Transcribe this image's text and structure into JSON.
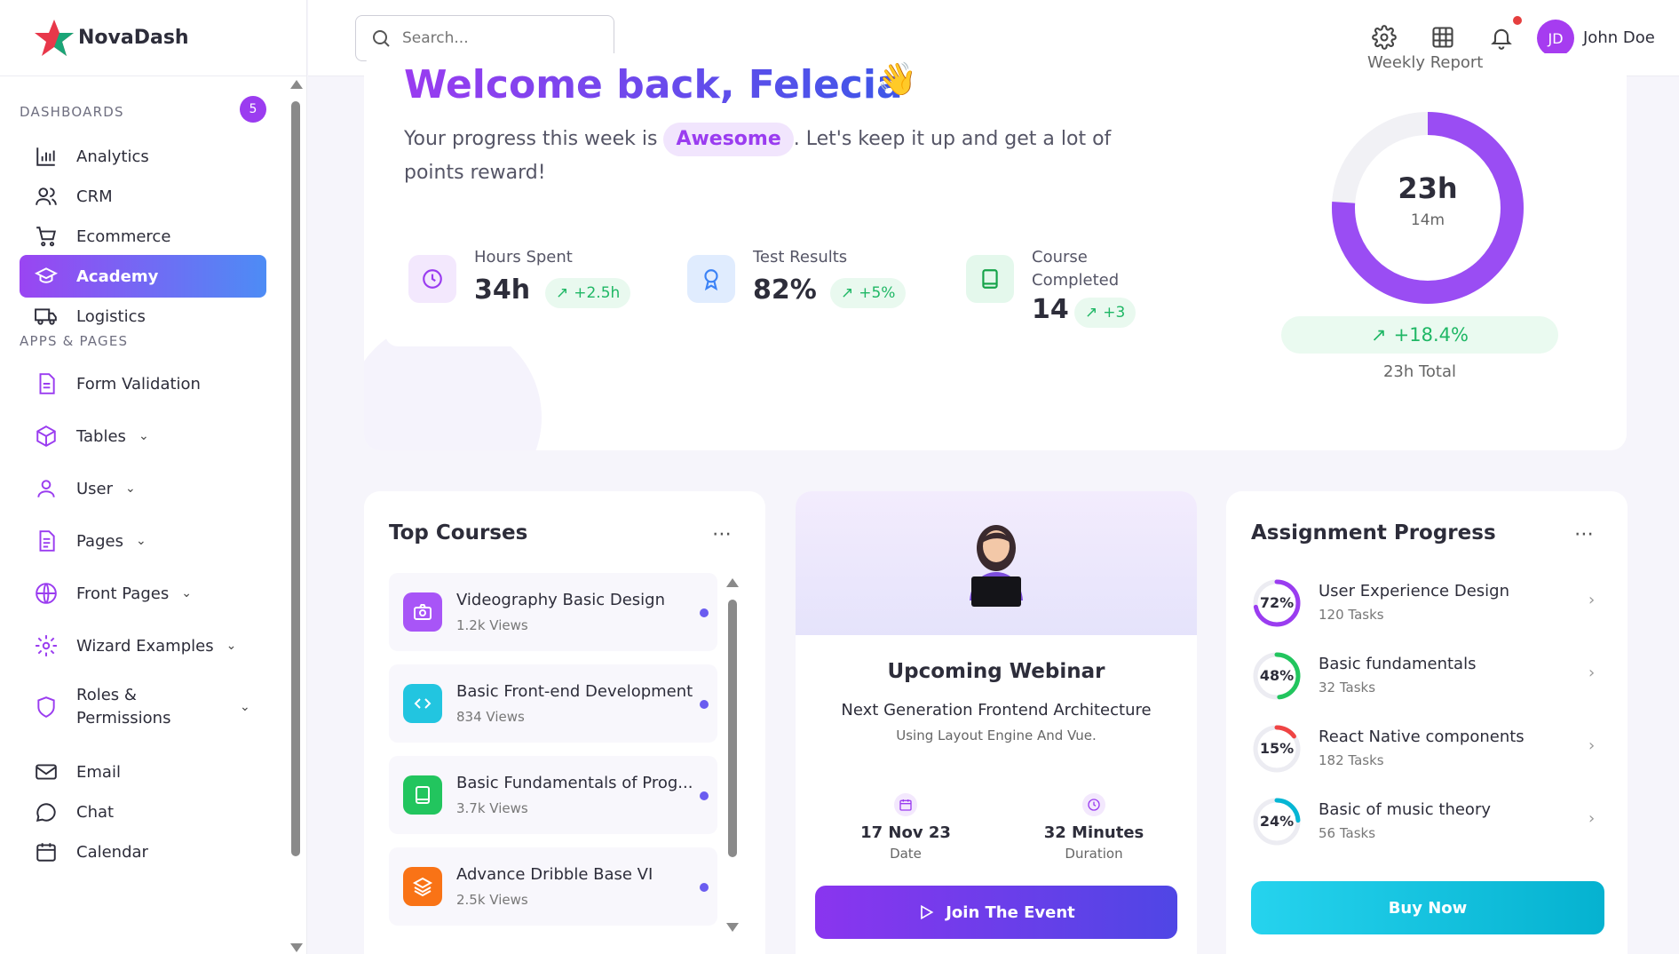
{
  "brand": {
    "name": "NovaDash",
    "icon": "star-logo"
  },
  "search": {
    "placeholder": "Search..."
  },
  "user": {
    "initials": "JD",
    "name": "John Doe"
  },
  "sidebar": {
    "dashboards_title": "DASHBOARDS",
    "dashboards_badge": "5",
    "apps_title": "APPS & PAGES",
    "items": [
      {
        "label": "Analytics",
        "icon": "bar-chart-icon"
      },
      {
        "label": "CRM",
        "icon": "users-icon"
      },
      {
        "label": "Ecommerce",
        "icon": "cart-icon"
      },
      {
        "label": "Academy",
        "icon": "graduation-cap-icon",
        "active": true
      },
      {
        "label": "Logistics",
        "icon": "truck-icon"
      },
      {
        "label": "Form Validation",
        "icon": "document-icon"
      },
      {
        "label": "Tables",
        "icon": "cube-icon"
      },
      {
        "label": "User",
        "icon": "user-icon"
      },
      {
        "label": "Pages",
        "icon": "file-icon"
      },
      {
        "label": "Front Pages",
        "icon": "globe-icon"
      },
      {
        "label": "Wizard Examples",
        "icon": "gear-icon"
      },
      {
        "label": "Roles &",
        "label2": "Permissions",
        "icon": "shield-icon"
      },
      {
        "label": "Email",
        "icon": "mail-icon"
      },
      {
        "label": "Chat",
        "icon": "chat-icon"
      },
      {
        "label": "Calendar",
        "icon": "calendar-icon"
      }
    ]
  },
  "welcome": {
    "title": "Welcome back, Felecia",
    "wave": "👋",
    "progress_prefix": "Your progress this week is",
    "progress_badge": "Awesome",
    "progress_suffix": ". Let's keep it up and get a lot of points reward!"
  },
  "stats": [
    {
      "label": "Hours Spent",
      "value": "34h",
      "trend": "+2.5h",
      "color": "#9a3cf0"
    },
    {
      "label": "Test Results",
      "value": "82%",
      "trend": "+5%",
      "color": "#3b82f6"
    },
    {
      "label": "Course",
      "label2": "Completed",
      "value": "14",
      "trend": "+3",
      "color": "#16a34a"
    }
  ],
  "weekly": {
    "label": "Weekly Report",
    "hours": "23h",
    "minutes": "14m",
    "progress": 0.76,
    "growth": "+18.4%",
    "total": "23h Total",
    "accent": "#9a4df3"
  },
  "top_courses": {
    "title": "Top Courses",
    "items": [
      {
        "name": "Videography Basic Design",
        "views": "1.2k Views",
        "color": "#a855f7",
        "icon": "camera-icon"
      },
      {
        "name": "Basic Front-end Development",
        "views": "834 Views",
        "color": "#22c5e0",
        "icon": "code-icon"
      },
      {
        "name": "Basic Fundamentals of Prog...",
        "views": "3.7k Views",
        "color": "#22c55e",
        "icon": "book-icon"
      },
      {
        "name": "Advance Dribble Base VI",
        "views": "2.5k Views",
        "color": "#f97316",
        "icon": "layers-icon"
      }
    ]
  },
  "webinar": {
    "title": "Upcoming Webinar",
    "subtitle": "Next Generation Frontend Architecture",
    "subtitle2": "Using Layout Engine And Vue.",
    "date_value": "17 Nov 23",
    "date_label": "Date",
    "duration_value": "32 Minutes",
    "duration_label": "Duration",
    "button": "Join The Event"
  },
  "assignments": {
    "title": "Assignment Progress",
    "items": [
      {
        "pct": "72%",
        "value": 0.72,
        "name": "User Experience Design",
        "tasks": "120 Tasks",
        "color": "#9a3cf0"
      },
      {
        "pct": "48%",
        "value": 0.48,
        "name": "Basic fundamentals",
        "tasks": "32 Tasks",
        "color": "#22c55e"
      },
      {
        "pct": "15%",
        "value": 0.15,
        "name": "React Native components",
        "tasks": "182 Tasks",
        "color": "#ef4444"
      },
      {
        "pct": "24%",
        "value": 0.24,
        "name": "Basic of music theory",
        "tasks": "56 Tasks",
        "color": "#06b6d4"
      }
    ],
    "button": "Buy Now"
  }
}
